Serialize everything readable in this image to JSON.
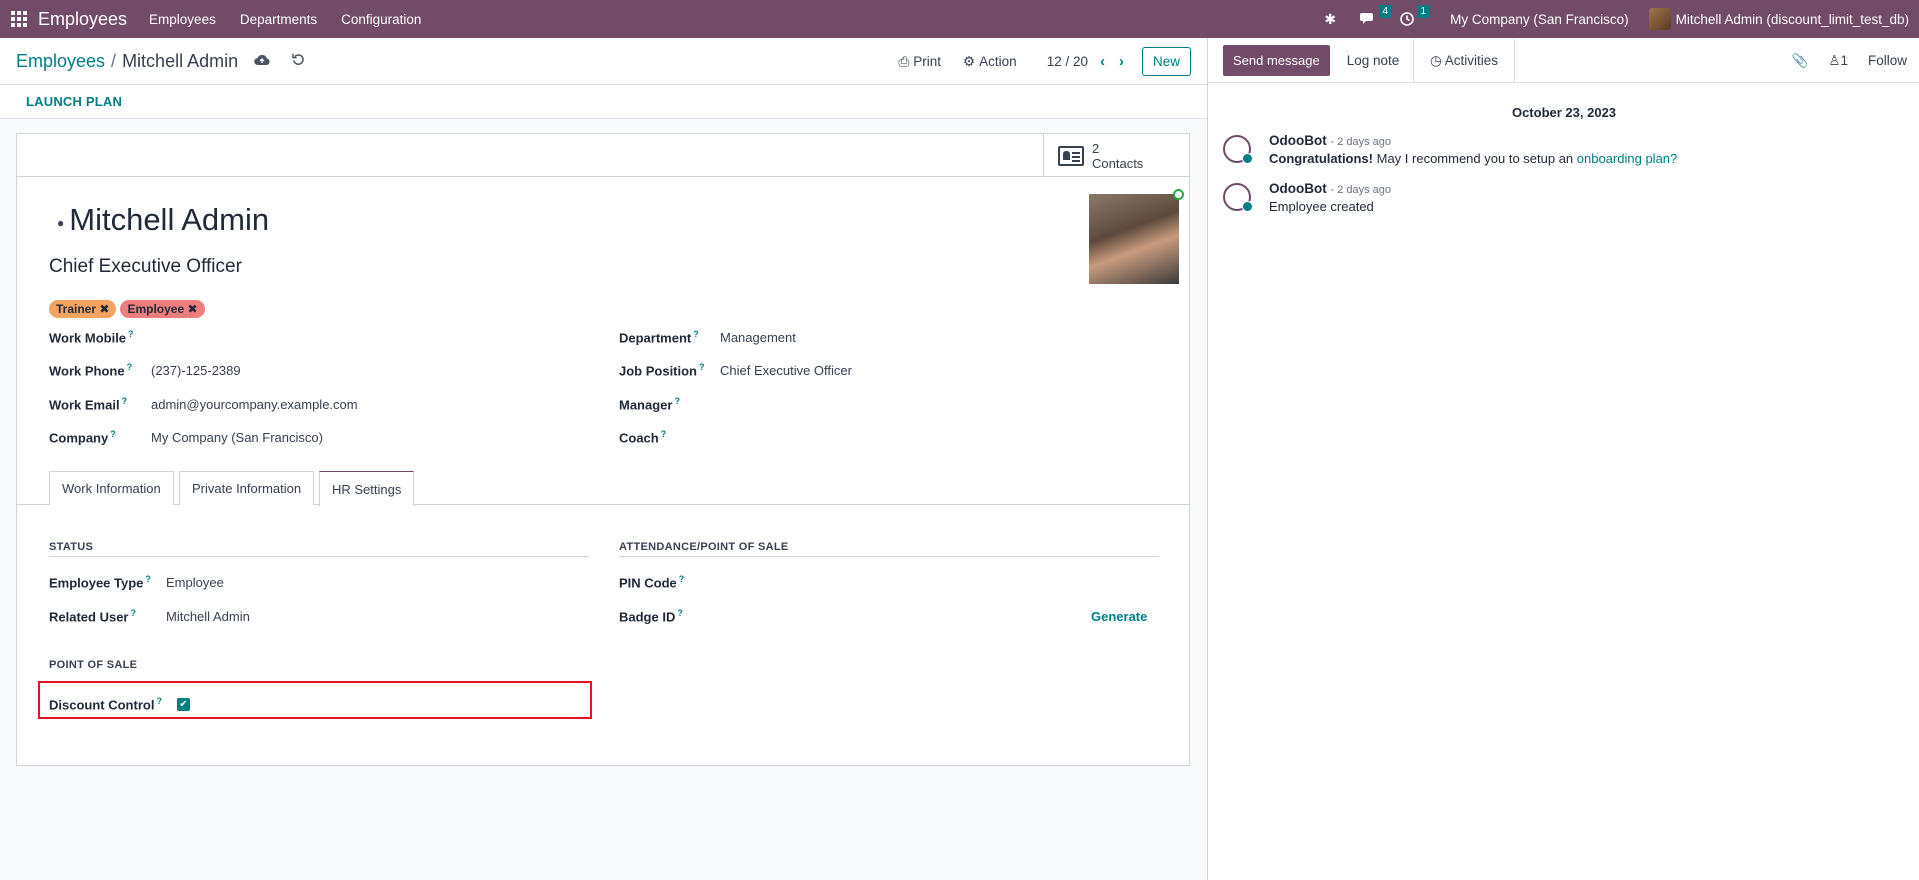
{
  "navbar": {
    "app_name": "Employees",
    "menu": [
      "Employees",
      "Departments",
      "Configuration"
    ],
    "messages_count": "4",
    "activities_count": "1",
    "company": "My Company (San Francisco)",
    "user": "Mitchell Admin (discount_limit_test_db)"
  },
  "control_panel": {
    "breadcrumb_parent": "Employees",
    "breadcrumb_sep": "/",
    "breadcrumb_current": "Mitchell Admin",
    "print_label": "Print",
    "action_label": "Action",
    "pager": "12 / 20",
    "new_label": "New"
  },
  "statusbar": {
    "launch_plan": "LAUNCH PLAN"
  },
  "smart_button": {
    "count": "2",
    "label": "Contacts"
  },
  "employee": {
    "name": "Mitchell Admin",
    "job_title": "Chief Executive Officer",
    "tags": [
      "Trainer",
      "Employee"
    ]
  },
  "fields_left": [
    {
      "label": "Work Mobile",
      "value": ""
    },
    {
      "label": "Work Phone",
      "value": "(237)-125-2389"
    },
    {
      "label": "Work Email",
      "value": "admin@yourcompany.example.com"
    },
    {
      "label": "Company",
      "value": "My Company (San Francisco)"
    }
  ],
  "fields_right": [
    {
      "label": "Department",
      "value": "Management"
    },
    {
      "label": "Job Position",
      "value": "Chief Executive Officer"
    },
    {
      "label": "Manager",
      "value": ""
    },
    {
      "label": "Coach",
      "value": ""
    }
  ],
  "tabs": [
    "Work Information",
    "Private Information",
    "HR Settings"
  ],
  "hr_settings": {
    "status_title": "STATUS",
    "employee_type_label": "Employee Type",
    "employee_type_value": "Employee",
    "related_user_label": "Related User",
    "related_user_value": "Mitchell Admin",
    "attendance_title": "ATTENDANCE/POINT OF SALE",
    "pin_label": "PIN Code",
    "badge_label": "Badge ID",
    "generate_label": "Generate",
    "pos_title": "POINT OF SALE",
    "discount_label": "Discount Control",
    "discount_checked": true
  },
  "chatter": {
    "send_message": "Send message",
    "log_note": "Log note",
    "activities": "Activities",
    "followers_count": "1",
    "follow": "Follow",
    "date": "October 23, 2023",
    "messages": [
      {
        "author": "OdooBot",
        "date": "- 2 days ago",
        "bold": "Congratulations!",
        "text": " May I recommend you to setup an ",
        "link": "onboarding plan?"
      },
      {
        "author": "OdooBot",
        "date": "- 2 days ago",
        "bold": "",
        "text": "Employee created",
        "link": ""
      }
    ]
  },
  "colors": {
    "brand": "#714b67",
    "accent": "#017e84",
    "highlight": "#e81123"
  }
}
